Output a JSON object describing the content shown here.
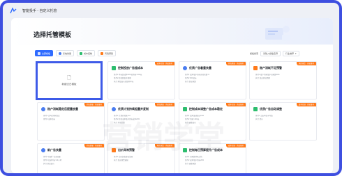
{
  "window": {
    "title": "智能投手 - 自定义托管"
  },
  "banner": {
    "heading": "选择托管模板"
  },
  "tabs": [
    {
      "label": "全部模板",
      "active": true,
      "icon": "grid-icon",
      "color": "#2f6bff"
    },
    {
      "label": "系统供量",
      "active": false,
      "icon": "drop-icon",
      "color": "#4a7cf0"
    },
    {
      "label": "成本控制",
      "active": false,
      "icon": "chart-icon",
      "color": "#2dbd6e"
    },
    {
      "label": "风险预警",
      "active": false,
      "icon": "warning-icon",
      "color": "#ff7a1a"
    }
  ],
  "filter": {
    "label": "模板搜索",
    "value": "请输入模板名称",
    "sort": "行业推荐"
  },
  "empty_template": {
    "icon": "document-icon",
    "label": "新建空白模板"
  },
  "cards": [
    {
      "title": "控制投放广告超成本",
      "icon": "chart-icon",
      "color": "#2dbd6e",
      "tag": "成本控制 · 系统推荐",
      "lines": [
        "条件1 单元超成本20%且消耗>200元",
        "条件2 转化数低于预期",
        "执行 降低出价或暂停单元"
      ]
    },
    {
      "title": "优质广告着重扶量",
      "icon": "drop-icon",
      "color": "#4a7cf0",
      "tag": "系统供量 · 系统推荐",
      "lines": [
        "条件1 成本低于目标且转化数>5",
        "条件2 ROI达标",
        "执行 提高预算"
      ]
    },
    {
      "title": "账户消耗不足预警",
      "icon": "warning-icon",
      "color": "#ff7a1a",
      "tag": "风险预警 · 系统推荐",
      "lines": [
        "条件1 账户消耗低于日预算50%",
        "执行 发送消息提醒"
      ]
    },
    {
      "title": "账户消耗稳定后提量放量",
      "icon": "drop-icon",
      "color": "#4a7cf0",
      "tag": "系统供量 · 系统推荐",
      "lines": [
        "条件1 近3日消耗稳定",
        "条件2 成本达标"
      ]
    },
    {
      "title": "优质计划持续起量并复制",
      "icon": "drop-icon",
      "color": "#4a7cf0",
      "tag": "系统供量 · 系统推荐",
      "lines": [
        "条件1 计划转化数>10",
        "条件2 转化成本低于目标成本20%",
        "执行 复制计划"
      ]
    },
    {
      "title": "控制成本调整广告成本稳定",
      "icon": "chart-icon",
      "color": "#2dbd6e",
      "tag": "成本控制 · 系统推荐",
      "lines": [
        "条件1 成本波动超过15%",
        "条件2 消耗>100元",
        "执行 调整出价"
      ]
    },
    {
      "title": "优质广告自动调整",
      "icon": "chart-icon",
      "color": "#2dbd6e",
      "tag": "成本控制 · 系统推荐",
      "lines": [
        "条件1 点击率高于均值",
        "执行 提价"
      ]
    },
    {
      "title": "新广告扶量",
      "icon": "drop-icon",
      "color": "#4a7cf0",
      "tag": "系统供量 · 系统推荐",
      "lines": [
        "条件1 新建广告未起量",
        "条件2 投放时长>24小时",
        "执行 提高出价"
      ]
    },
    {
      "title": "出价异常预警",
      "icon": "warning-icon",
      "color": "#ff7a1a",
      "tag": "风险预警 · 系统推荐",
      "lines": [
        "条件1 出价超出建议范围",
        "执行 发送预警通知"
      ]
    },
    {
      "title": "控制每日预算提升广告成本",
      "icon": "chart-icon",
      "color": "#2dbd6e",
      "tag": "成本控制 · 系统推荐",
      "lines": [
        "条件1 日预算消耗过快",
        "条件2 成本低于目标20%",
        "执行 调整预算"
      ]
    }
  ],
  "watermark": "营销学堂"
}
